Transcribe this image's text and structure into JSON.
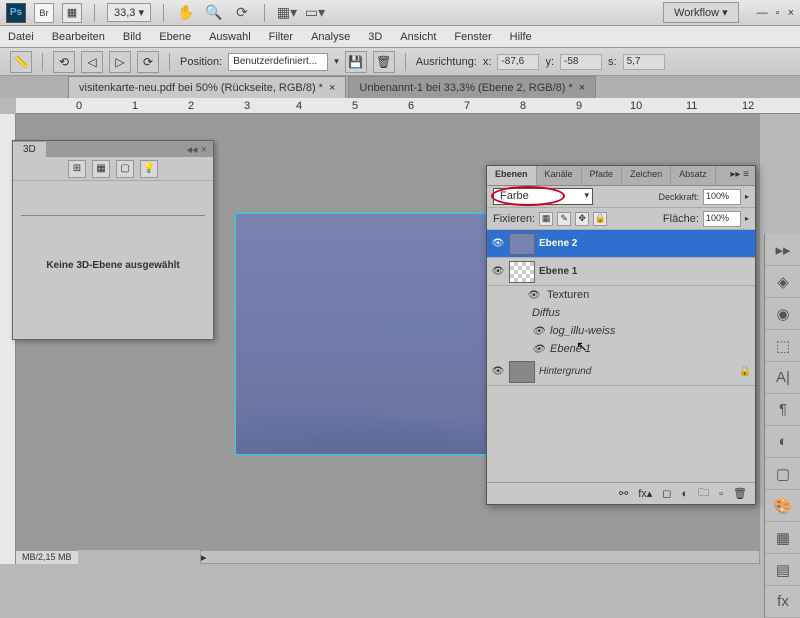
{
  "topbar": {
    "zoom": "33,3",
    "workflow": "Workflow ▾"
  },
  "menu": [
    "Datei",
    "Bearbeiten",
    "Bild",
    "Ebene",
    "Auswahl",
    "Filter",
    "Analyse",
    "3D",
    "Ansicht",
    "Fenster",
    "Hilfe"
  ],
  "options": {
    "position_label": "Position:",
    "position_value": "Benutzerdefiniert...",
    "ausrichtung": "Ausrichtung:",
    "x_label": "x:",
    "x": "-87,6",
    "y_label": "y:",
    "y": "-58",
    "s_label": "s:",
    "s": "5,7"
  },
  "tabs": [
    {
      "label": "visitenkarte-neu.pdf bei 50% (Rückseite, RGB/8) *"
    },
    {
      "label": "Unbenannt-1 bei 33,3% (Ebene 2, RGB/8) *"
    }
  ],
  "ruler": [
    "0",
    "1",
    "2",
    "3",
    "4",
    "5",
    "6",
    "7",
    "8",
    "9",
    "10",
    "11",
    "12"
  ],
  "panel3d": {
    "tab": "3D",
    "msg": "Keine 3D-Ebene ausgewählt"
  },
  "layers": {
    "tabs": [
      "Ebenen",
      "Kanäle",
      "Pfade",
      "Zeichen",
      "Absatz"
    ],
    "mode": "Farbe",
    "deckkraft_label": "Deckkraft:",
    "deckkraft": "100%",
    "fixieren": "Fixieren:",
    "flaeche_label": "Fläche:",
    "flaeche": "100%",
    "items": [
      {
        "name": "Ebene 2"
      },
      {
        "name": "Ebene 1"
      },
      {
        "group": "Texturen"
      },
      {
        "sub": "Diffus"
      },
      {
        "subitem": "log_illu-weiss"
      },
      {
        "subitem2": "Ebene 1"
      },
      {
        "bg": "Hintergrund"
      }
    ]
  },
  "status": "MB/2,15 MB"
}
